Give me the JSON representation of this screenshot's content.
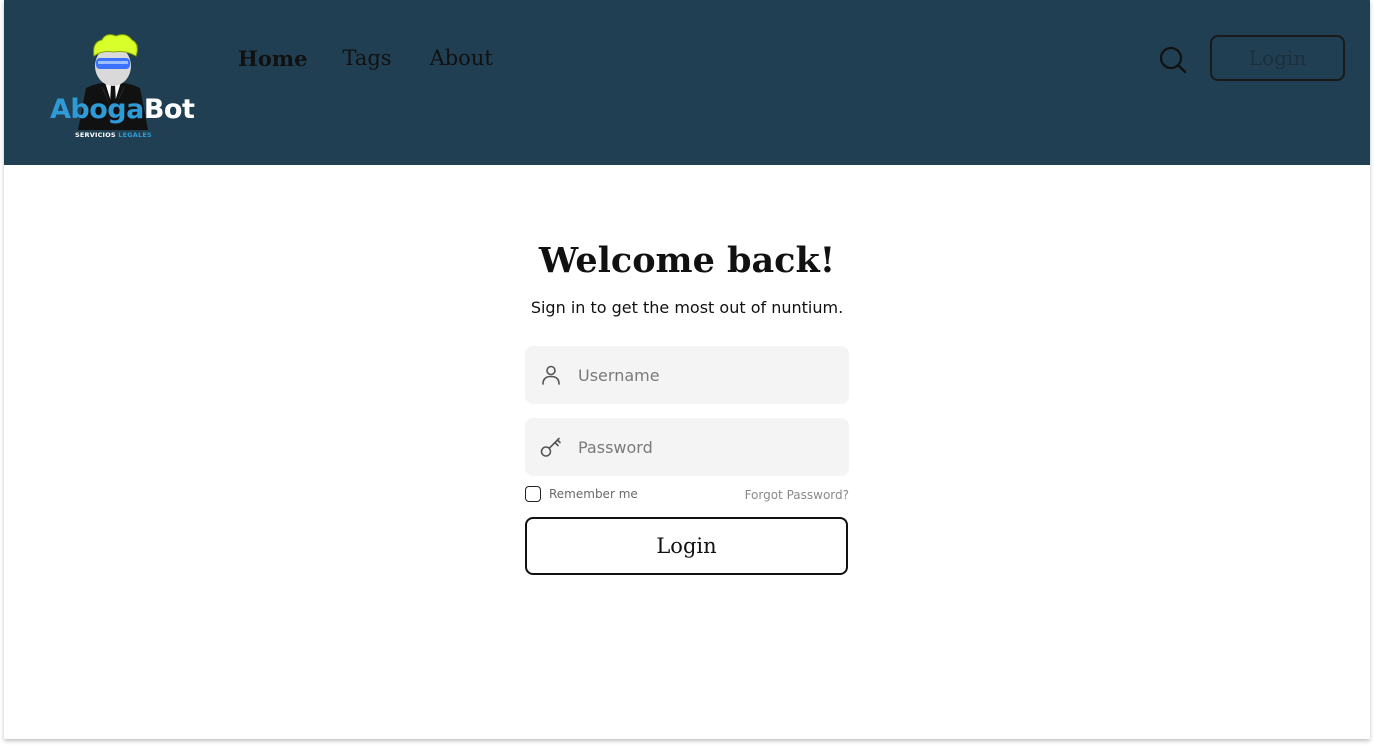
{
  "brand": {
    "name_part1": "Aboga",
    "name_part2": "Bot",
    "tagline_part1": "SERVICIOS",
    "tagline_part2": "LEGALES",
    "accent_color": "#2e9bd6",
    "hair_color": "#d8ff2a"
  },
  "header": {
    "background": "#213f52",
    "nav": [
      {
        "label": "Home"
      },
      {
        "label": "Tags"
      },
      {
        "label": "About"
      }
    ],
    "search_icon": "search-icon",
    "login_label": "Login"
  },
  "main": {
    "title": "Welcome back!",
    "subtitle": "Sign in to get the most out of nuntium.",
    "username": {
      "placeholder": "Username",
      "value": "",
      "icon": "user-icon"
    },
    "password": {
      "placeholder": "Password",
      "value": "",
      "icon": "key-icon"
    },
    "remember_label": "Remember me",
    "remember_checked": false,
    "forgot_label": "Forgot Password?",
    "login_label": "Login"
  }
}
